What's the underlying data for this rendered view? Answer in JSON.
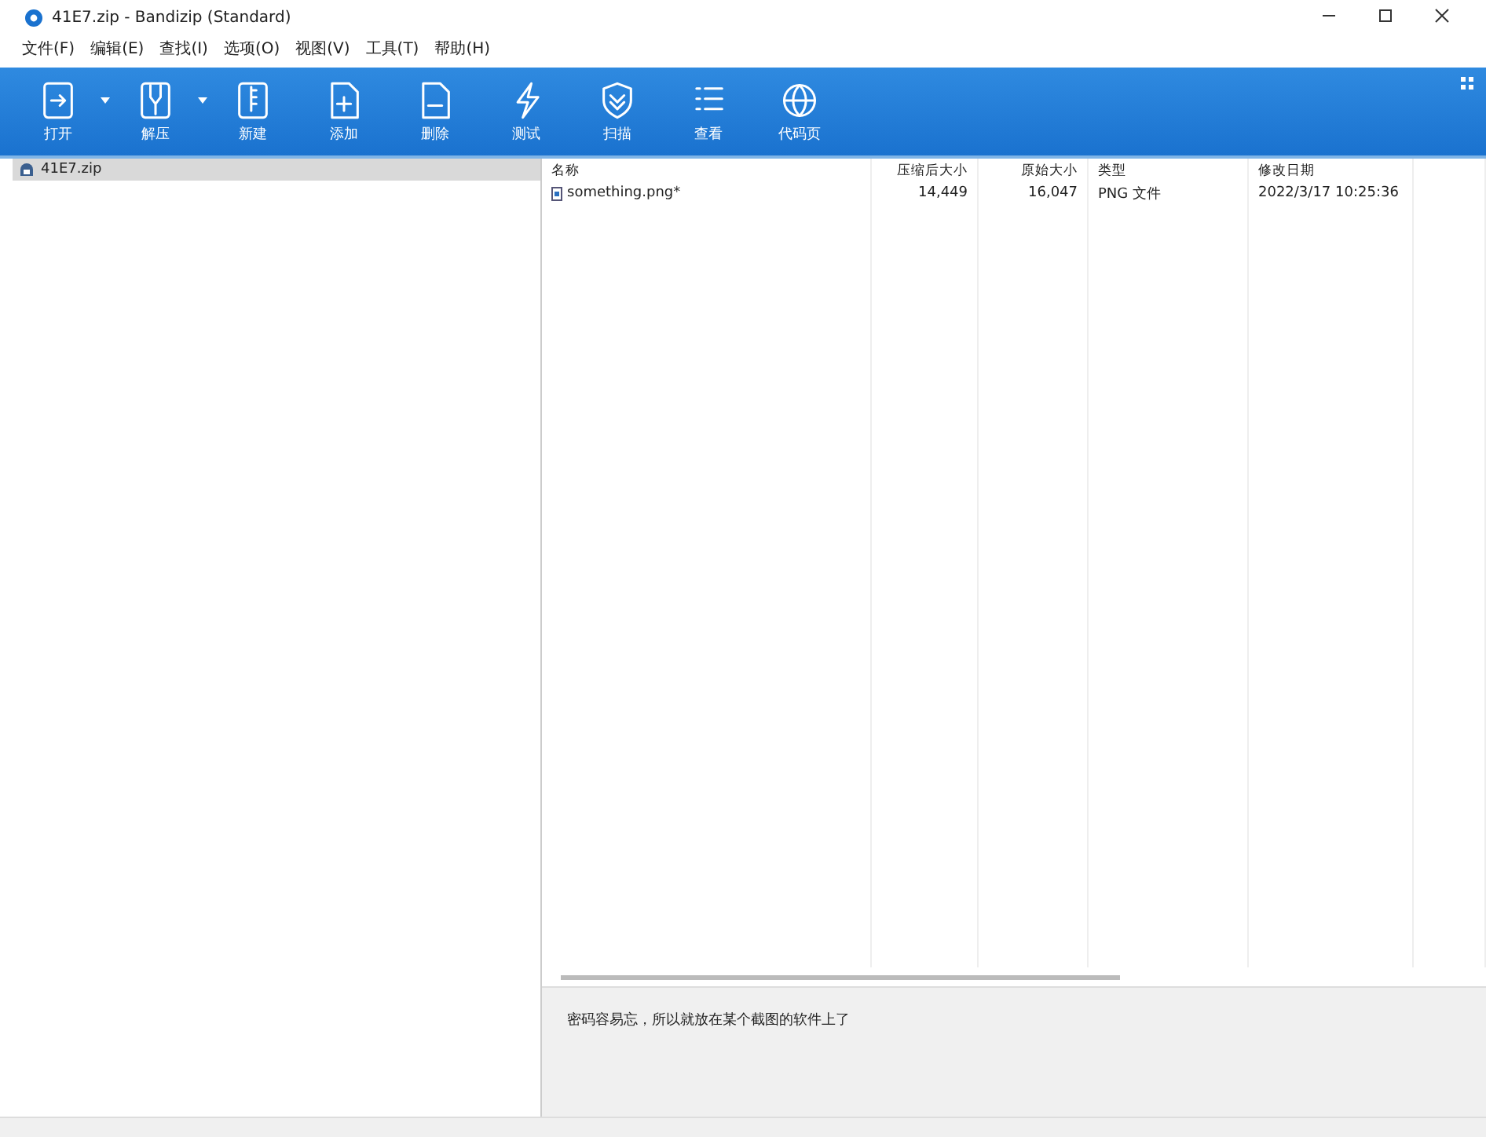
{
  "window": {
    "title": "41E7.zip - Bandizip (Standard)"
  },
  "menu": [
    "文件(F)",
    "编辑(E)",
    "查找(I)",
    "选项(O)",
    "视图(V)",
    "工具(T)",
    "帮助(H)"
  ],
  "toolbar": [
    {
      "kind": "open",
      "label": "打开",
      "dropdown": true
    },
    {
      "kind": "extract",
      "label": "解压",
      "dropdown": true
    },
    {
      "kind": "new",
      "label": "新建",
      "dropdown": false
    },
    {
      "kind": "add",
      "label": "添加",
      "dropdown": false
    },
    {
      "kind": "delete",
      "label": "删除",
      "dropdown": false
    },
    {
      "kind": "test",
      "label": "测试",
      "dropdown": false
    },
    {
      "kind": "scan",
      "label": "扫描",
      "dropdown": false
    },
    {
      "kind": "view",
      "label": "查看",
      "dropdown": false
    },
    {
      "kind": "codepage",
      "label": "代码页",
      "dropdown": false
    }
  ],
  "tree": [
    {
      "label": "41E7.zip",
      "selected": true
    }
  ],
  "table": {
    "columns": [
      "名称",
      "压缩后大小",
      "原始大小",
      "类型",
      "修改日期"
    ],
    "rows": [
      {
        "name": "something.png*",
        "compressed": "14,449",
        "original": "16,047",
        "type": "PNG 文件",
        "modified": "2022/3/17 10:25:36"
      }
    ]
  },
  "comment": "密码容易忘，所以就放在某个截图的软件上了"
}
